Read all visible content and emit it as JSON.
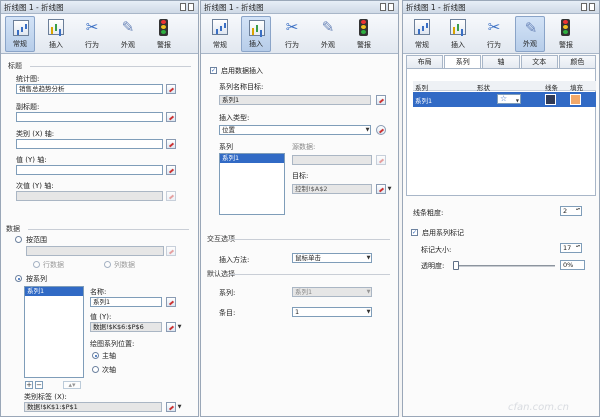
{
  "panels": [
    {
      "title": "折线图 1 - 折线图"
    },
    {
      "title": "折线图 1 - 折线图"
    },
    {
      "title": "折线图 1 - 折线图"
    }
  ],
  "ribbon": {
    "general": "常规",
    "insert": "插入",
    "behavior": "行为",
    "appearance": "外观",
    "alerts": "警报"
  },
  "general": {
    "section_title": "标题",
    "chart_title_label": "统计图:",
    "chart_title_value": "销售总趋势分析",
    "subtitle_label": "副标题:",
    "category_axis_label": "类别 (X) 轴:",
    "value_axis_label": "值 (Y) 轴:",
    "secondary_axis_label": "次值 (Y) 轴:",
    "data_section": "数据",
    "by_range": "按范围",
    "row_data": "行数据",
    "col_data": "列数据",
    "by_series": "按系列",
    "series_item": "系列1",
    "name_label": "名称:",
    "name_value": "系列1",
    "values_label": "值 (Y):",
    "values_value": "数据!$K$6:$P$6",
    "plot_pos_label": "绘图系列位置:",
    "primary_axis": "主轴",
    "secondary_axis": "次轴",
    "category_labels_label": "类别标签 (X):",
    "category_labels_value": "数据!$K$1:$P$1"
  },
  "insertp": {
    "enable_label": "启用数据插入",
    "series_name_target_label": "系列名称目标:",
    "series_name_target_value": "系列1",
    "insert_type_label": "插入类型:",
    "insert_type_value": "位置",
    "series_label": "系列",
    "series_item": "系列1",
    "source_label": "源数据:",
    "target_label": "目标:",
    "target_value": "控制!$A$2",
    "interaction_section": "交互选项",
    "insert_method_label": "插入方法:",
    "insert_method_value": "鼠标单击",
    "default_section": "默认选择",
    "default_series_label": "系列:",
    "default_series_value": "系列1",
    "item_label": "条目:",
    "item_value": "1"
  },
  "appearancep": {
    "tabs": [
      "布局",
      "系列",
      "轴",
      "文本",
      "颜色"
    ],
    "col_series": "系列",
    "col_shape": "形状",
    "col_line": "线条",
    "col_fill": "填充",
    "row_series": "系列1",
    "line_width_label": "线条粗度:",
    "line_width_value": "2",
    "enable_marker_label": "启用系列标记",
    "marker_size_label": "标记大小:",
    "marker_size_value": "17",
    "transparency_label": "透明度:",
    "transparency_value": "0%",
    "colors": {
      "line": "#2f3a56",
      "fill": "#f2a86a"
    }
  },
  "watermark": "cfan.com.cn"
}
